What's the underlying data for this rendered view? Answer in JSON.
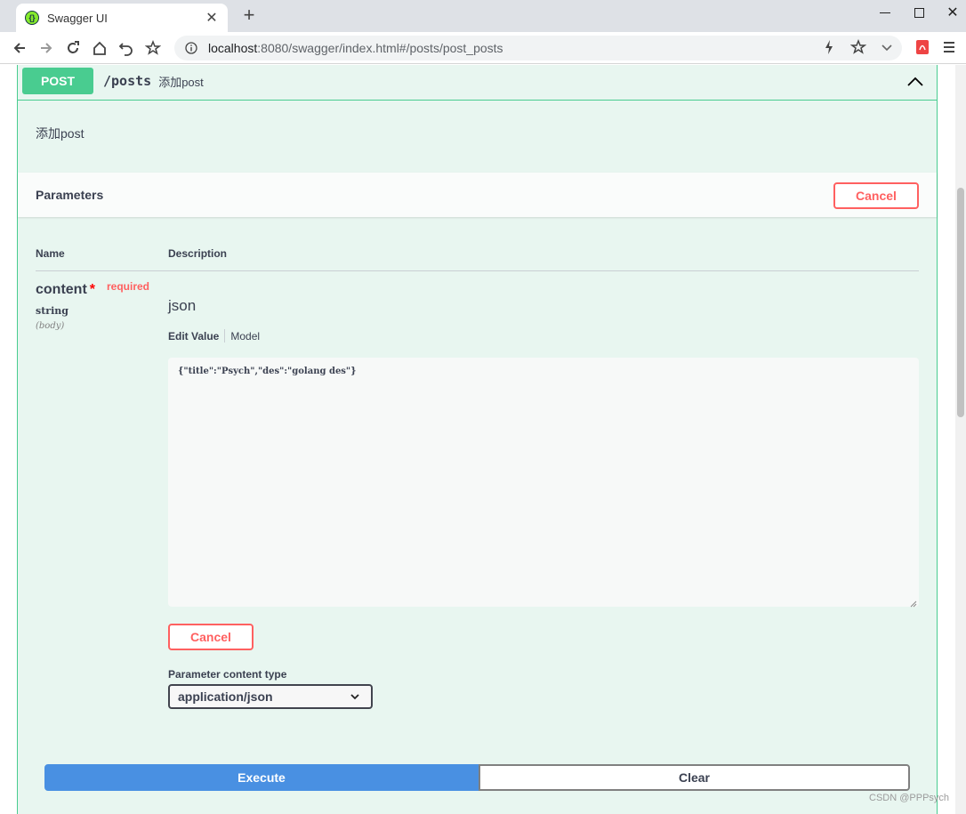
{
  "browser": {
    "tab_title": "Swagger UI",
    "url_host": "localhost",
    "url_rest": ":8080/swagger/index.html#/posts/post_posts"
  },
  "operation": {
    "method": "POST",
    "path": "/posts",
    "summary": "添加post",
    "description": "添加post"
  },
  "parameters": {
    "title": "Parameters",
    "cancel_label": "Cancel",
    "col_name": "Name",
    "col_description": "Description",
    "param": {
      "name": "content",
      "star": "*",
      "required": "required",
      "type": "string",
      "in": "(body)",
      "description": "json",
      "tab_edit": "Edit Value",
      "tab_model": "Model",
      "value": "{\"title\":\"Psych\",\"des\":\"golang des\"}"
    },
    "body_cancel_label": "Cancel",
    "content_type_label": "Parameter content type",
    "content_type_value": "application/json"
  },
  "actions": {
    "execute": "Execute",
    "clear": "Clear"
  },
  "watermark": "CSDN @PPPsych",
  "colors": {
    "post_green": "#49cc90",
    "cancel_red": "#ff6060",
    "execute_blue": "#4990e2"
  }
}
